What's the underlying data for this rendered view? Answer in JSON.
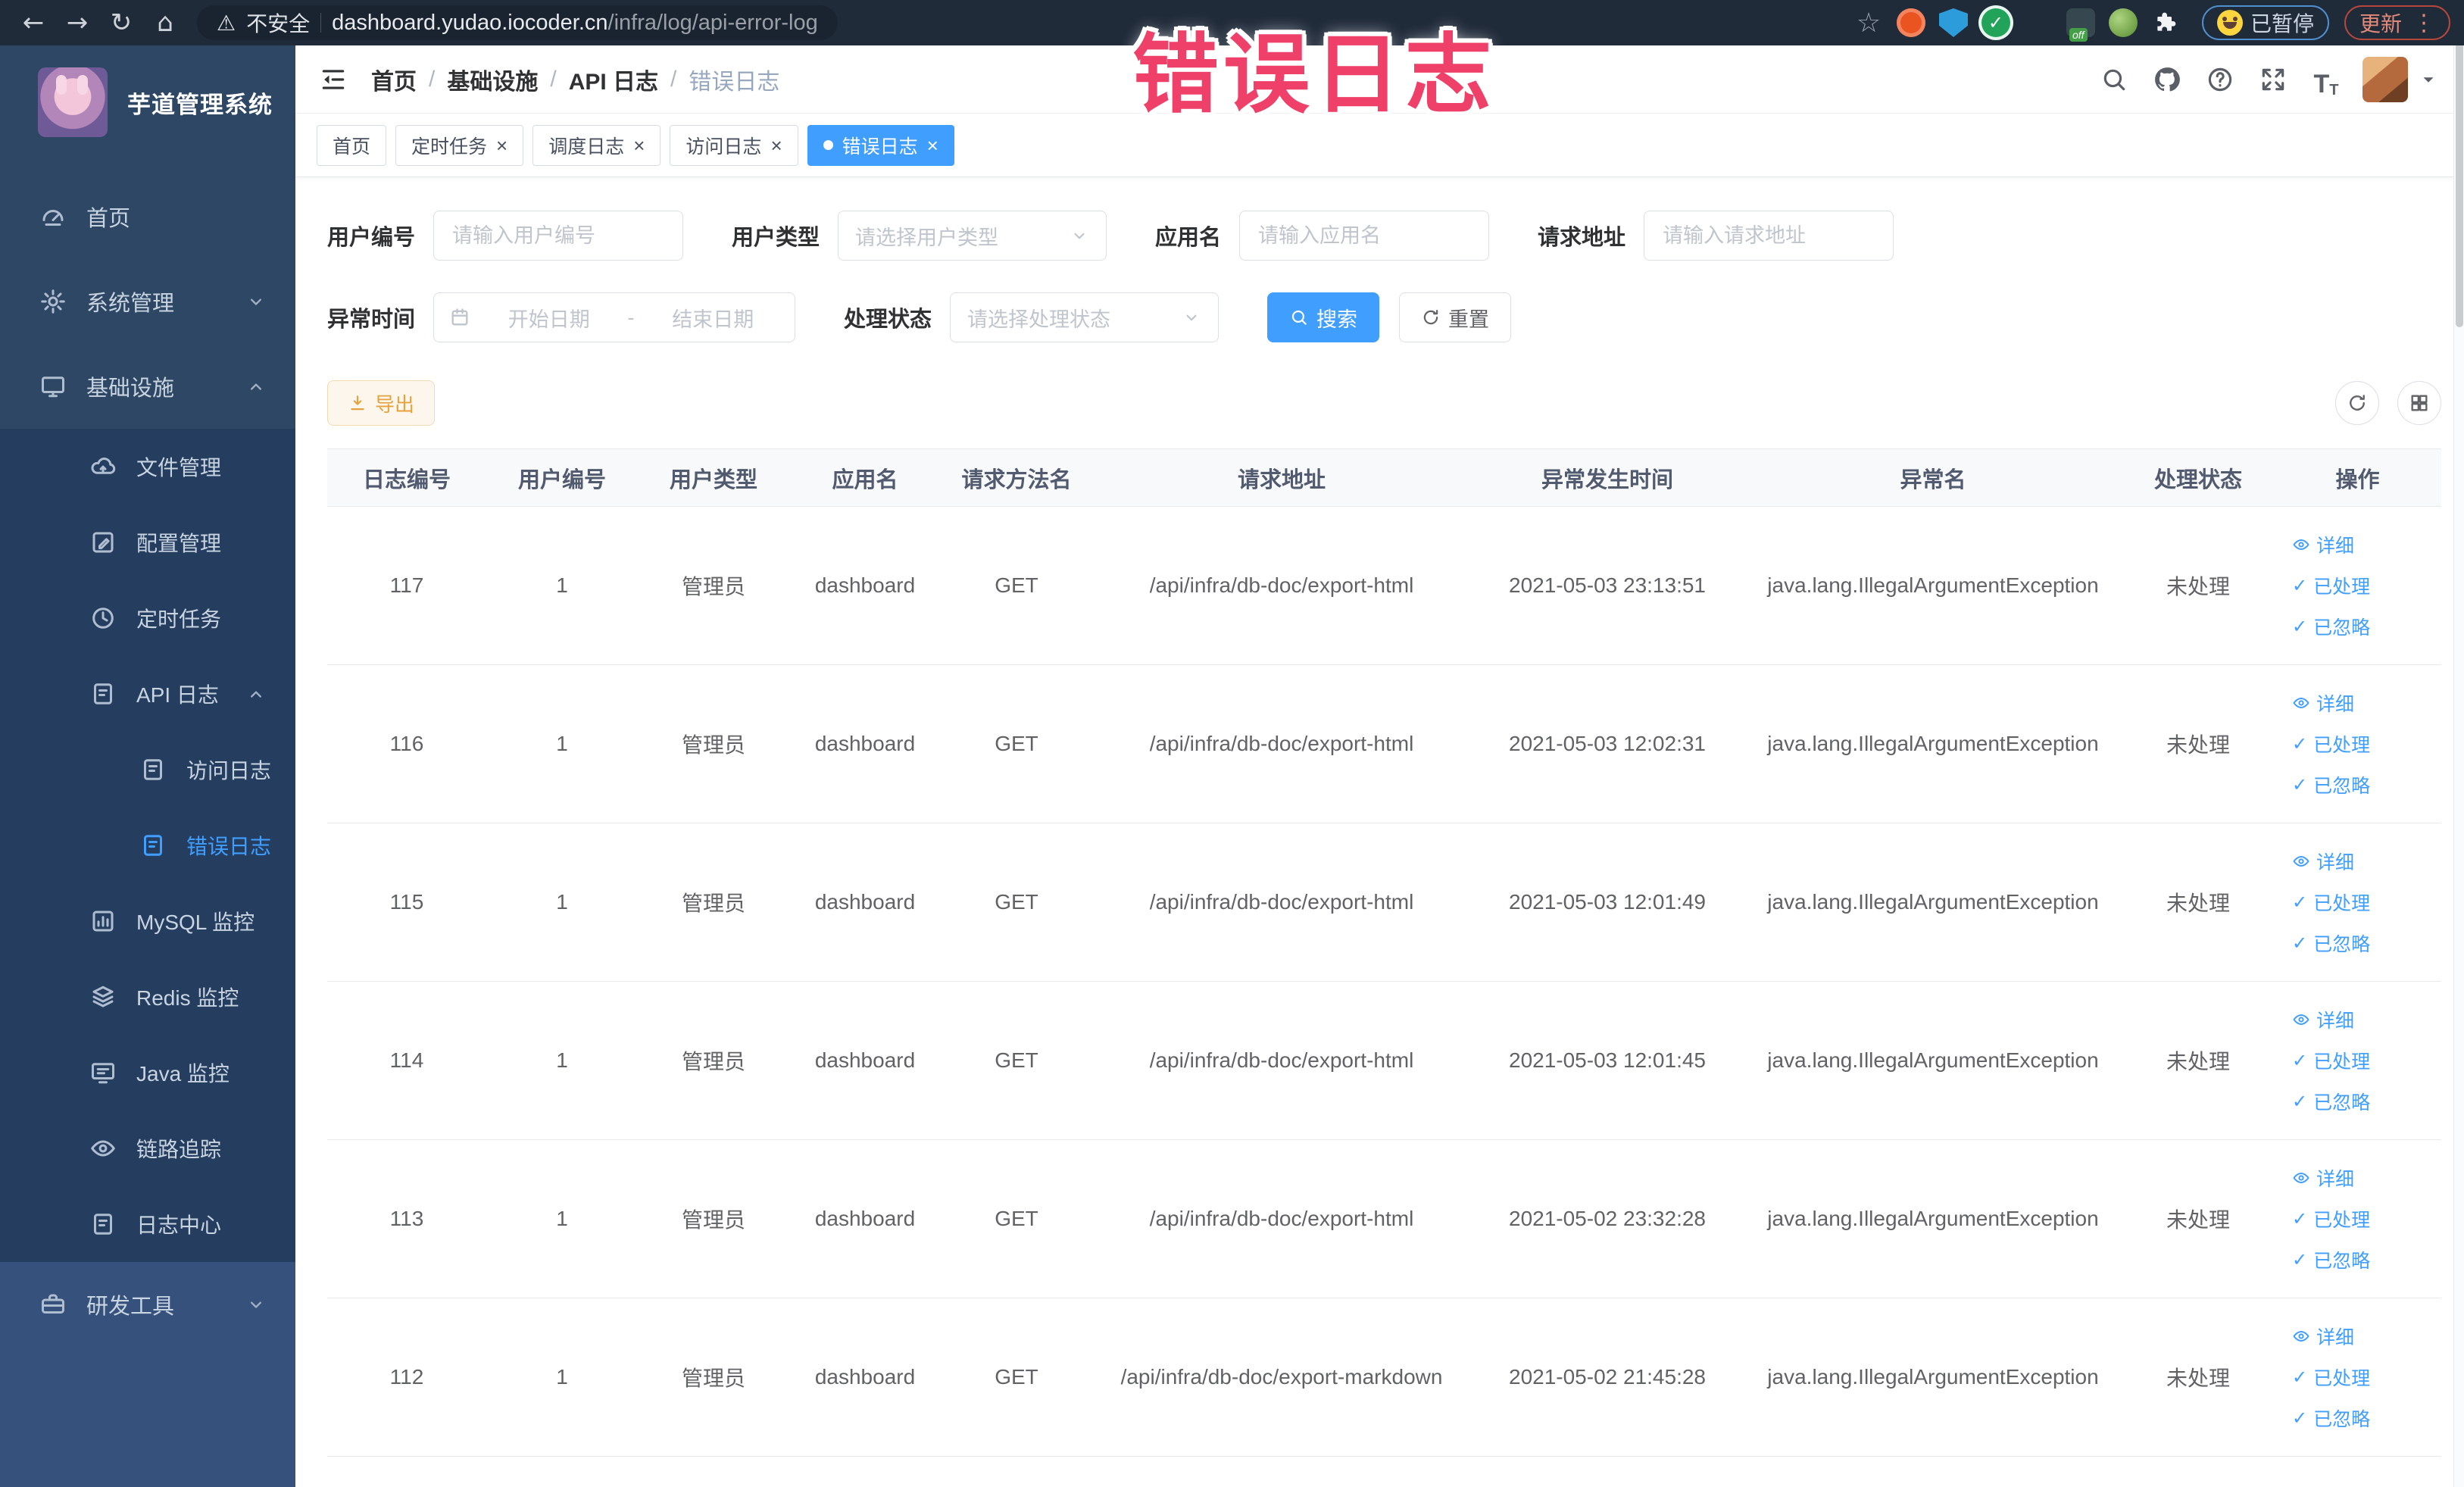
{
  "annotation": {
    "text": "错误日志",
    "color": "#ef4069"
  },
  "colors": {
    "accent_blue": "#409eff",
    "active_tab": "#409eff",
    "export_orange": "#e6a23c",
    "sidebar_bg": "#2e4764",
    "chrome_bg": "#202b3a",
    "link": "#409eff"
  },
  "browser": {
    "insecure_label": "不安全",
    "url_host": "dashboard.yudao.iocoder.cn",
    "url_path": "/infra/log/api-error-log",
    "paused_badge": "已暂停",
    "update_badge": "更新",
    "extensions": [
      {
        "name": "bookmark-star-icon",
        "type": "star"
      },
      {
        "name": "extension-orange-icon",
        "type": "orange"
      },
      {
        "name": "extension-shield-icon",
        "type": "shield"
      },
      {
        "name": "extension-green-check-icon",
        "type": "greencheck"
      },
      {
        "name": "extension-grid-icon",
        "type": "grid"
      },
      {
        "name": "extension-toggle-icon",
        "type": "toggle",
        "badge": "off"
      },
      {
        "name": "extension-leaf-icon",
        "type": "leaf"
      },
      {
        "name": "extensions-puzzle-icon",
        "type": "puzzle"
      }
    ]
  },
  "sidebar": {
    "app_title": "芋道管理系统",
    "items": [
      {
        "key": "home",
        "label": "首页",
        "icon": "gauge-icon",
        "level": 1
      },
      {
        "key": "system-mgmt",
        "label": "系统管理",
        "icon": "gear-icon",
        "level": 1,
        "chevron": "down"
      },
      {
        "key": "infrastructure",
        "label": "基础设施",
        "icon": "monitor-icon",
        "level": 1,
        "chevron": "up"
      },
      {
        "key": "file-mgmt",
        "label": "文件管理",
        "icon": "cloud-upload-icon",
        "level": 2
      },
      {
        "key": "config-mgmt",
        "label": "配置管理",
        "icon": "edit-icon",
        "level": 2
      },
      {
        "key": "scheduled-jobs",
        "label": "定时任务",
        "icon": "clock-icon",
        "level": 2
      },
      {
        "key": "api-logs",
        "label": "API 日志",
        "icon": "notebook-icon",
        "level": 2,
        "chevron": "up"
      },
      {
        "key": "access-log",
        "label": "访问日志",
        "icon": "notebook-icon",
        "level": 3
      },
      {
        "key": "error-log",
        "label": "错误日志",
        "icon": "notebook-icon",
        "level": 3,
        "active": true
      },
      {
        "key": "mysql-monitor",
        "label": "MySQL 监控",
        "icon": "chart-icon",
        "level": 2
      },
      {
        "key": "redis-monitor",
        "label": "Redis 监控",
        "icon": "layers-icon",
        "level": 2
      },
      {
        "key": "java-monitor",
        "label": "Java 监控",
        "icon": "java-monitor-icon",
        "level": 2
      },
      {
        "key": "trace",
        "label": "链路追踪",
        "icon": "eye-icon",
        "level": 2
      },
      {
        "key": "log-center",
        "label": "日志中心",
        "icon": "notebook-icon",
        "level": 2
      },
      {
        "key": "dev-tools",
        "label": "研发工具",
        "icon": "toolbox-icon",
        "level": 1,
        "chevron": "down",
        "section": "light"
      }
    ]
  },
  "header": {
    "breadcrumbs": [
      "首页",
      "基础设施",
      "API 日志",
      "错误日志"
    ]
  },
  "tabs": [
    {
      "key": "home",
      "label": "首页",
      "closable": false
    },
    {
      "key": "scheduled-jobs",
      "label": "定时任务",
      "closable": true
    },
    {
      "key": "job-log",
      "label": "调度日志",
      "closable": true
    },
    {
      "key": "access-log",
      "label": "访问日志",
      "closable": true
    },
    {
      "key": "error-log",
      "label": "错误日志",
      "closable": true,
      "active": true
    }
  ],
  "filters": {
    "user_id": {
      "label": "用户编号",
      "placeholder": "请输入用户编号"
    },
    "user_type": {
      "label": "用户类型",
      "placeholder": "请选择用户类型"
    },
    "app_name": {
      "label": "应用名",
      "placeholder": "请输入应用名"
    },
    "request_url": {
      "label": "请求地址",
      "placeholder": "请输入请求地址"
    },
    "exception_time": {
      "label": "异常时间",
      "start_placeholder": "开始日期",
      "separator": "-",
      "end_placeholder": "结束日期"
    },
    "process_status": {
      "label": "处理状态",
      "placeholder": "请选择处理状态"
    },
    "search_label": "搜索",
    "reset_label": "重置"
  },
  "toolbar": {
    "export_label": "导出"
  },
  "table": {
    "headers": [
      "日志编号",
      "用户编号",
      "用户类型",
      "应用名",
      "请求方法名",
      "请求地址",
      "异常发生时间",
      "异常名",
      "处理状态",
      "操作"
    ],
    "actions": [
      {
        "key": "detail",
        "label": "详细",
        "icon": "eye-icon"
      },
      {
        "key": "processed",
        "label": "已处理",
        "icon": "check-icon"
      },
      {
        "key": "ignored",
        "label": "已忽略",
        "icon": "check-icon"
      }
    ],
    "rows": [
      {
        "id": "117",
        "user_id": "1",
        "user_type": "管理员",
        "app": "dashboard",
        "method": "GET",
        "url": "/api/infra/db-doc/export-html",
        "time": "2021-05-03 23:13:51",
        "exception": "java.lang.IllegalArgumentException",
        "status": "未处理"
      },
      {
        "id": "116",
        "user_id": "1",
        "user_type": "管理员",
        "app": "dashboard",
        "method": "GET",
        "url": "/api/infra/db-doc/export-html",
        "time": "2021-05-03 12:02:31",
        "exception": "java.lang.IllegalArgumentException",
        "status": "未处理"
      },
      {
        "id": "115",
        "user_id": "1",
        "user_type": "管理员",
        "app": "dashboard",
        "method": "GET",
        "url": "/api/infra/db-doc/export-html",
        "time": "2021-05-03 12:01:49",
        "exception": "java.lang.IllegalArgumentException",
        "status": "未处理"
      },
      {
        "id": "114",
        "user_id": "1",
        "user_type": "管理员",
        "app": "dashboard",
        "method": "GET",
        "url": "/api/infra/db-doc/export-html",
        "time": "2021-05-03 12:01:45",
        "exception": "java.lang.IllegalArgumentException",
        "status": "未处理"
      },
      {
        "id": "113",
        "user_id": "1",
        "user_type": "管理员",
        "app": "dashboard",
        "method": "GET",
        "url": "/api/infra/db-doc/export-html",
        "time": "2021-05-02 23:32:28",
        "exception": "java.lang.IllegalArgumentException",
        "status": "未处理"
      },
      {
        "id": "112",
        "user_id": "1",
        "user_type": "管理员",
        "app": "dashboard",
        "method": "GET",
        "url": "/api/infra/db-doc/export-markdown",
        "time": "2021-05-02 21:45:28",
        "exception": "java.lang.IllegalArgumentException",
        "status": "未处理"
      }
    ]
  }
}
